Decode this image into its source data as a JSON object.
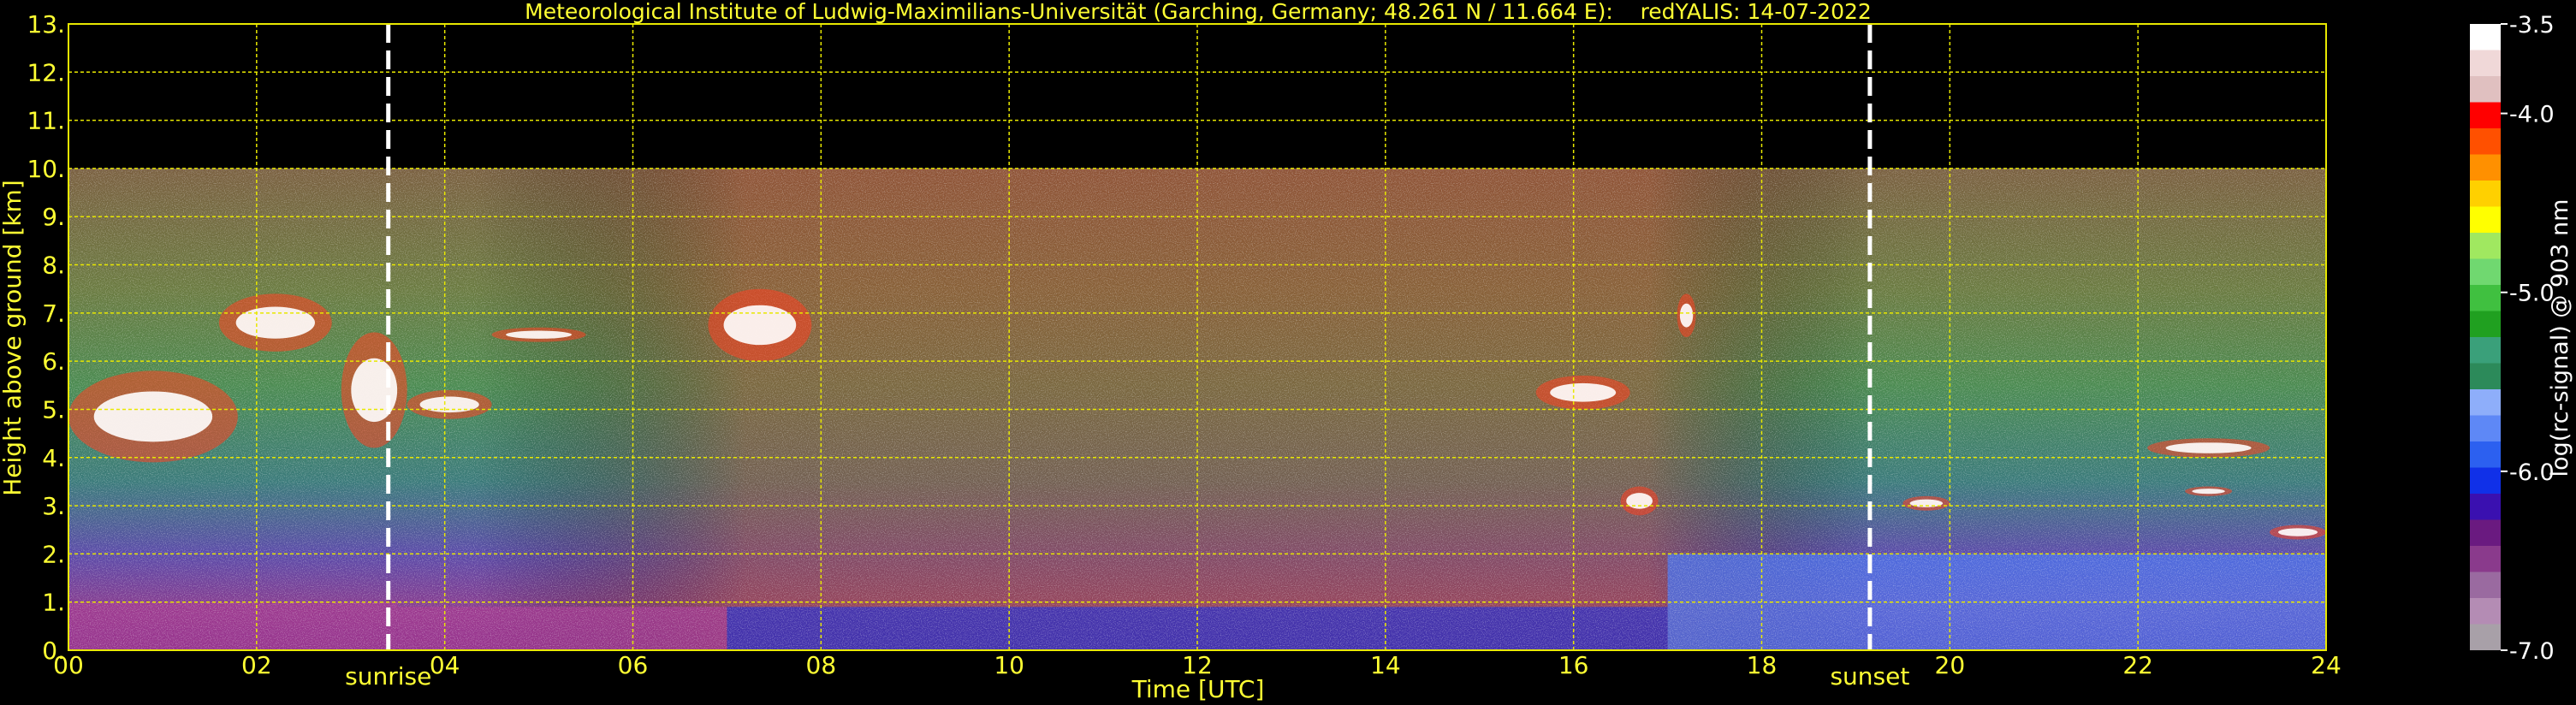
{
  "chart_data": {
    "type": "heatmap",
    "title": "Meteorological Institute of Ludwig-Maximilians-Universität (Garching, Germany; 48.261 N / 11.664 E):    redYALIS: 14-07-2022",
    "xlabel": "Time [UTC]",
    "ylabel": "Height above ground [km]",
    "xlim": [
      0,
      24
    ],
    "ylim": [
      0,
      13
    ],
    "x_ticks": [
      0,
      2,
      4,
      6,
      8,
      10,
      12,
      14,
      16,
      18,
      20,
      22,
      24
    ],
    "x_tick_labels": [
      "00",
      "02",
      "04",
      "06",
      "08",
      "10",
      "12",
      "14",
      "16",
      "18",
      "20",
      "22",
      "24"
    ],
    "y_ticks": [
      0,
      1,
      2,
      3,
      4,
      5,
      6,
      7,
      8,
      9,
      10,
      11,
      12,
      13
    ],
    "y_tick_labels": [
      "0.",
      "1.",
      "2.",
      "3.",
      "4.",
      "5.",
      "6.",
      "7.",
      "8.",
      "9.",
      "10.",
      "11.",
      "12.",
      "13."
    ],
    "grid": true,
    "data_top_km": 10,
    "markers": [
      {
        "label": "sunrise",
        "x": 3.4
      },
      {
        "label": "sunset",
        "x": 19.15
      }
    ],
    "colorbar": {
      "label": "log(rc-signal) @ 903 nm",
      "range": [
        -7.0,
        -3.5
      ],
      "ticks": [
        -3.5,
        -4.0,
        -5.0,
        -6.0,
        -7.0
      ],
      "tick_labels": [
        "-3.5",
        "-4.0",
        "-5.0",
        "-6.0",
        "-7.0"
      ],
      "colors": [
        "#a8a0a8",
        "#b48cb4",
        "#9a6aa0",
        "#8a3a8c",
        "#6a1a80",
        "#3a10b0",
        "#1030e8",
        "#2c60f0",
        "#5e88f6",
        "#8eaefa",
        "#2c8a5a",
        "#3aa07a",
        "#20a020",
        "#40c040",
        "#70d870",
        "#a0e860",
        "#ffff00",
        "#ffd000",
        "#ff9000",
        "#ff5000",
        "#ff0000",
        "#e0c0c0",
        "#f0d8d8",
        "#ffffff"
      ]
    },
    "clouds": [
      {
        "t0": 0.0,
        "t1": 1.8,
        "h0": 3.9,
        "h1": 5.8
      },
      {
        "t0": 1.6,
        "t1": 2.8,
        "h0": 6.2,
        "h1": 7.4
      },
      {
        "t0": 2.9,
        "t1": 3.6,
        "h0": 4.2,
        "h1": 6.6
      },
      {
        "t0": 3.6,
        "t1": 4.5,
        "h0": 4.8,
        "h1": 5.4
      },
      {
        "t0": 4.5,
        "t1": 5.5,
        "h0": 6.4,
        "h1": 6.7
      },
      {
        "t0": 6.8,
        "t1": 7.9,
        "h0": 6.0,
        "h1": 7.5
      },
      {
        "t0": 15.6,
        "t1": 16.6,
        "h0": 5.0,
        "h1": 5.7
      },
      {
        "t0": 16.5,
        "t1": 16.9,
        "h0": 2.8,
        "h1": 3.4
      },
      {
        "t0": 17.1,
        "t1": 17.3,
        "h0": 6.5,
        "h1": 7.4
      },
      {
        "t0": 19.5,
        "t1": 20.0,
        "h0": 2.9,
        "h1": 3.2
      },
      {
        "t0": 22.1,
        "t1": 23.4,
        "h0": 4.0,
        "h1": 4.4
      },
      {
        "t0": 22.5,
        "t1": 23.0,
        "h0": 3.2,
        "h1": 3.4
      },
      {
        "t0": 23.4,
        "t1": 24.0,
        "h0": 2.3,
        "h1": 2.6
      }
    ],
    "boundary_layer": [
      {
        "t0": 0.0,
        "t1": 3.5,
        "h1": 1.0
      },
      {
        "t0": 3.5,
        "t1": 7.0,
        "h1": 0.9
      },
      {
        "t0": 7.0,
        "t1": 17.0,
        "h1": 0.9
      },
      {
        "t0": 17.0,
        "t1": 24.0,
        "h1": 2.0
      }
    ]
  }
}
